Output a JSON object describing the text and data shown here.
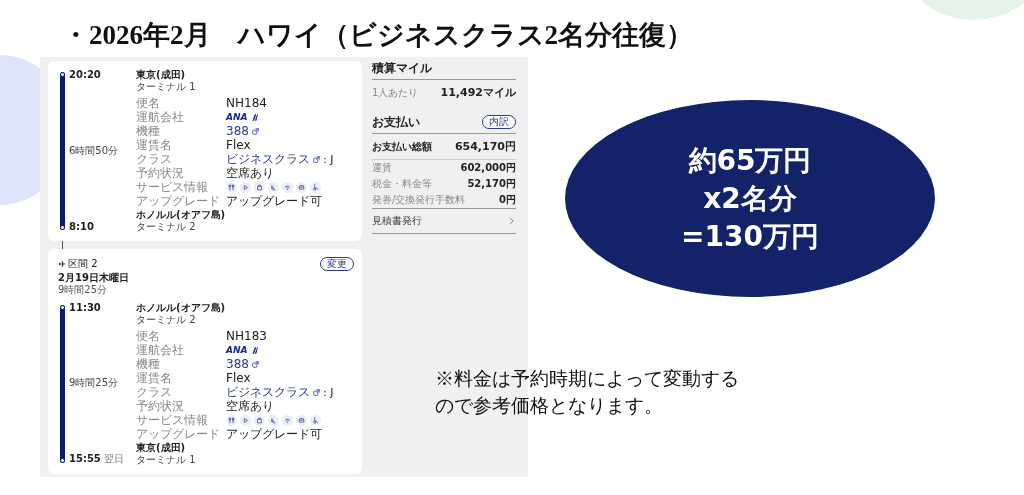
{
  "slide_title": "・2026年2月　ハワイ（ビジネスクラス2名分往復）",
  "segments": [
    {
      "legs": [
        {
          "dep_time": "20:20",
          "dep_airport": "東京(成田)",
          "dep_terminal": "ターミナル 1",
          "duration": "6時間50分",
          "arr_time": "8:10",
          "arr_airport": "ホノルル(オアフ島)",
          "arr_terminal": "ターミナル 2",
          "details": [
            {
              "label": "便名",
              "kind": "text",
              "value": "NH184"
            },
            {
              "label": "運航会社",
              "kind": "logo",
              "value": "ANA"
            },
            {
              "label": "機種",
              "kind": "link",
              "value": "388"
            },
            {
              "label": "運賃名",
              "kind": "text",
              "value": "Flex"
            },
            {
              "label": "クラス",
              "kind": "class",
              "value": "ビジネスクラス",
              "suffix": ": J"
            },
            {
              "label": "予約状況",
              "kind": "text",
              "value": "空席あり"
            },
            {
              "label": "サービス情報",
              "kind": "icons"
            },
            {
              "label": "アップグレード",
              "kind": "text",
              "value": "アップグレード可"
            }
          ]
        }
      ]
    },
    {
      "header": {
        "section": "区間 2",
        "date": "2月19日木曜日",
        "duration": "9時間25分",
        "button": "変更"
      },
      "legs": [
        {
          "dep_time": "11:30",
          "dep_airport": "ホノルル(オアフ島)",
          "dep_terminal": "ターミナル 2",
          "duration": "9時間25分",
          "arr_time": "15:55",
          "arr_note": "翌日",
          "arr_airport": "東京(成田)",
          "arr_terminal": "ターミナル 1",
          "details": [
            {
              "label": "便名",
              "kind": "text",
              "value": "NH183"
            },
            {
              "label": "運航会社",
              "kind": "logo",
              "value": "ANA"
            },
            {
              "label": "機種",
              "kind": "link",
              "value": "388"
            },
            {
              "label": "運賃名",
              "kind": "text",
              "value": "Flex"
            },
            {
              "label": "クラス",
              "kind": "class",
              "value": "ビジネスクラス",
              "suffix": ": J"
            },
            {
              "label": "予約状況",
              "kind": "text",
              "value": "空席あり"
            },
            {
              "label": "サービス情報",
              "kind": "icons"
            },
            {
              "label": "アップグレード",
              "kind": "text",
              "value": "アップグレード可"
            }
          ]
        }
      ]
    }
  ],
  "miles": {
    "title": "積算マイル",
    "label": "1人あたり",
    "value": "11,492マイル"
  },
  "payment": {
    "title": "お支払い",
    "button": "内訳",
    "total_label": "お支払い総額",
    "total_value": "654,170円",
    "items": [
      {
        "label": "運賃",
        "value": "602,000円"
      },
      {
        "label": "税金・料金等",
        "value": "52,170円"
      },
      {
        "label": "発券/交換発行手数料",
        "value": "0円"
      }
    ],
    "link": "見積書発行"
  },
  "callout": [
    "約65万円",
    "x2名分",
    "=130万円"
  ],
  "note": "※料金は予約時期によって変動するので参考価格となります。"
}
